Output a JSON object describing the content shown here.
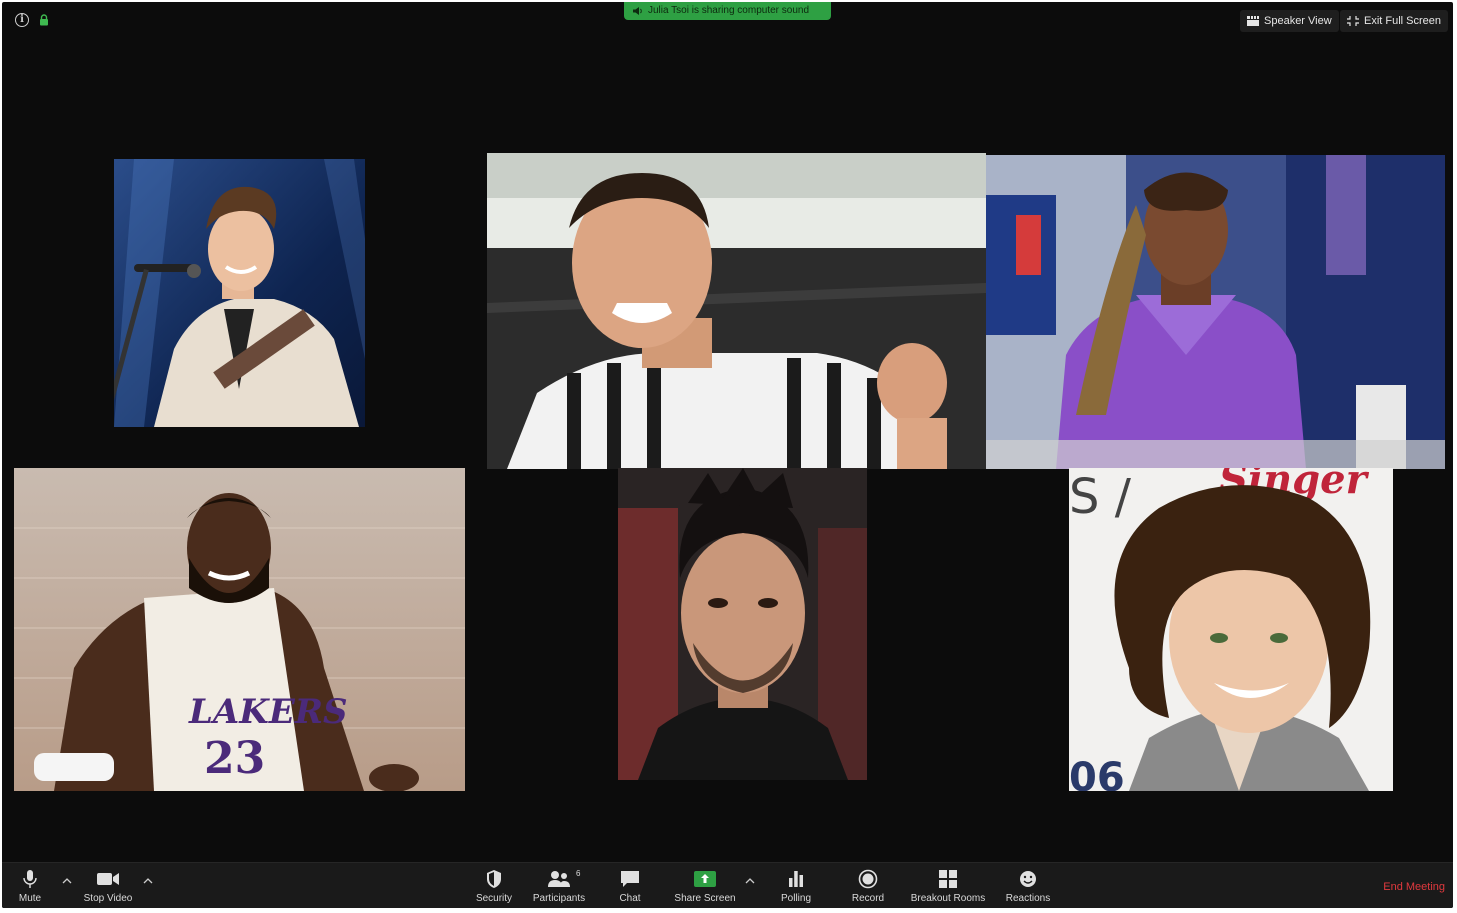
{
  "top_bar": {
    "share_notice": "Julia Tsoi is sharing computer sound",
    "speaker_view_label": "Speaker View",
    "exit_fullscreen_label": "Exit Full Screen"
  },
  "toolbar": {
    "mute_label": "Mute",
    "stop_video_label": "Stop Video",
    "security_label": "Security",
    "participants_label": "Participants",
    "participants_count": "6",
    "chat_label": "Chat",
    "share_screen_label": "Share Screen",
    "polling_label": "Polling",
    "record_label": "Record",
    "breakout_rooms_label": "Breakout Rooms",
    "reactions_label": "Reactions",
    "end_meeting_label": "End Meeting"
  },
  "participants": [
    {
      "id": "p1",
      "tile": "top-left"
    },
    {
      "id": "p2",
      "tile": "top-center"
    },
    {
      "id": "p3",
      "tile": "top-right"
    },
    {
      "id": "p4",
      "tile": "bottom-left"
    },
    {
      "id": "p5",
      "tile": "bottom-center"
    },
    {
      "id": "p6",
      "tile": "bottom-right"
    }
  ],
  "colors": {
    "background": "#0c0c0c",
    "toolbar": "#1a1a1a",
    "share_green": "#2ea043",
    "end_red": "#e0393e"
  },
  "icons": [
    "info-icon",
    "lock-icon",
    "speaker-icon",
    "grid-icon",
    "exit-fullscreen-icon",
    "microphone-icon",
    "video-camera-icon",
    "shield-icon",
    "participants-icon",
    "chat-icon",
    "share-screen-icon",
    "polling-icon",
    "record-icon",
    "breakout-rooms-icon",
    "reactions-icon",
    "chevron-up-icon"
  ]
}
